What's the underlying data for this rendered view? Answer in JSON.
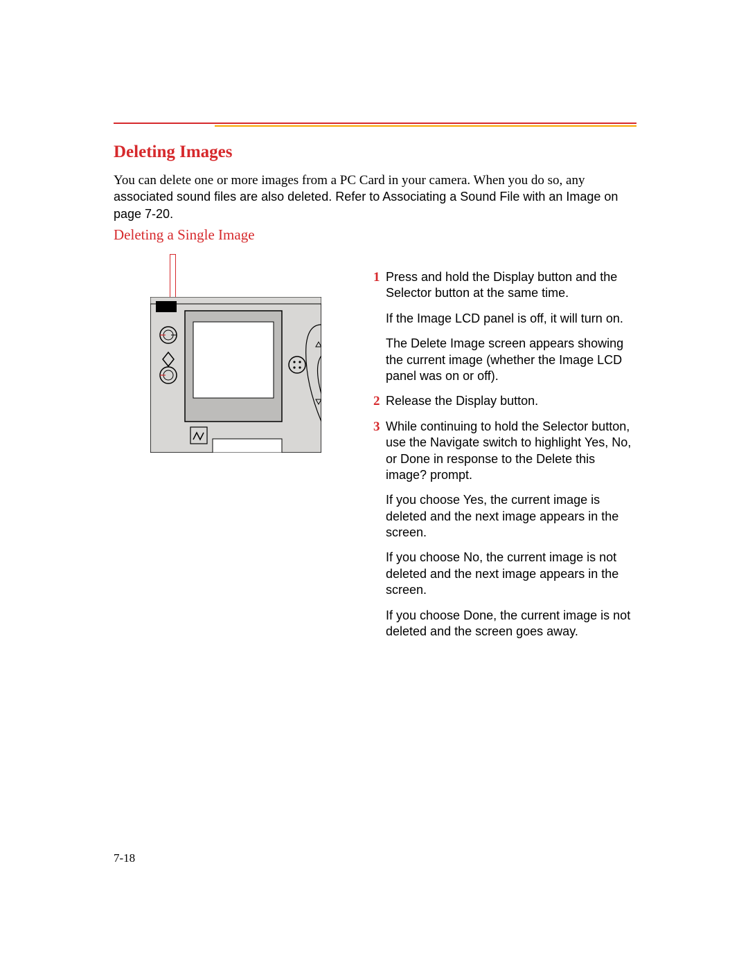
{
  "headings": {
    "h1": "Deleting Images",
    "h2": "Deleting a Single Image"
  },
  "intro": {
    "part1": "You can delete one or more images from a PC Card in your camera. When you do so, any ",
    "part2": "associated sound files are also deleted. Refer to  Associating a Sound File with an Image  on page 7-20."
  },
  "steps": [
    {
      "num": "1",
      "paragraphs": [
        "Press and hold the Display button and the Selector button at the same time.",
        "If the Image LCD panel is off, it will turn on.",
        "The Delete Image screen appears showing the current image (whether the Image LCD panel was on or off)."
      ]
    },
    {
      "num": "2",
      "paragraphs": [
        "Release the Display button."
      ]
    },
    {
      "num": "3",
      "paragraphs": [
        "While continuing to hold the Selector button, use the Navigate switch to highlight Yes, No, or Done in response to the  Delete this image?  prompt.",
        "If you choose Yes, the current image is deleted and the next image appears in the screen.",
        "If you choose No, the current image is not deleted and the next image appears in the screen.",
        "If you choose Done, the current image is not deleted and the screen goes away."
      ]
    }
  ],
  "page_number": "7-18"
}
